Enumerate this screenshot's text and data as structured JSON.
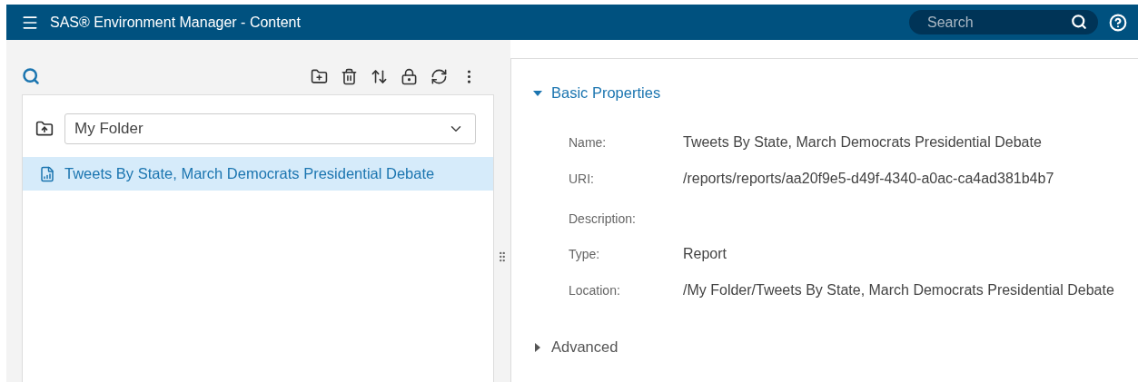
{
  "header": {
    "title": "SAS® Environment Manager - Content",
    "search": {
      "placeholder": "Search"
    }
  },
  "folder_select": {
    "value": "My Folder"
  },
  "items": [
    {
      "label": "Tweets By State, March Democrats Presidential Debate",
      "selected": true
    }
  ],
  "sections": [
    {
      "title": "Basic Properties",
      "expanded": true,
      "properties": [
        {
          "label": "Name:",
          "value": "Tweets By State, March Democrats Presidential Debate"
        },
        {
          "label": "URI:",
          "value": "/reports/reports/aa20f9e5-d49f-4340-a0ac-ca4ad381b4b7"
        },
        {
          "label": "Description:"
        },
        {
          "label": "Type:",
          "value": "Report"
        },
        {
          "label": "Location:",
          "value": "/My Folder/Tweets By State, March Democrats Presidential Debate"
        }
      ]
    },
    {
      "title": "Advanced",
      "expanded": false
    }
  ]
}
